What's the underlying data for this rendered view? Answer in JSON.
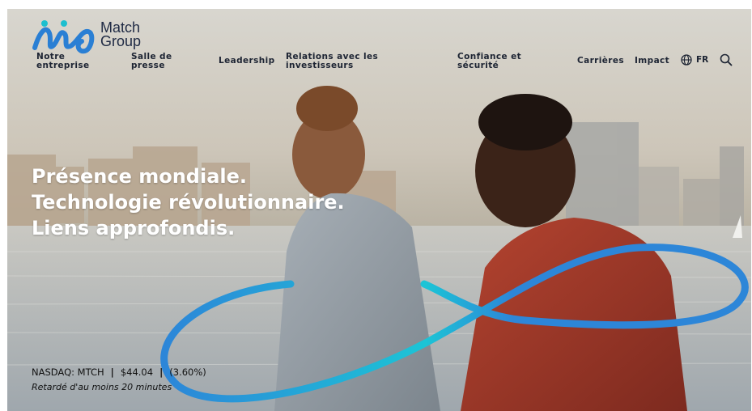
{
  "brand": {
    "name_line1": "Match",
    "name_line2": "Group"
  },
  "nav": {
    "items": [
      {
        "label_line1": "Notre",
        "label_line2": "entreprise"
      },
      {
        "label_line1": "Salle de",
        "label_line2": "presse"
      },
      {
        "label_line1": "Leadership",
        "label_line2": ""
      },
      {
        "label_line1": "Relations avec les",
        "label_line2": "investisseurs"
      },
      {
        "label_line1": "Confiance et",
        "label_line2": "sécurité"
      },
      {
        "label_line1": "Carrières",
        "label_line2": ""
      },
      {
        "label_line1": "Impact",
        "label_line2": ""
      }
    ],
    "language": "FR"
  },
  "hero": {
    "headline_lines": [
      "Présence mondiale.",
      "Technologie révolutionnaire.",
      "Liens approfondis."
    ]
  },
  "stock": {
    "ticker": "NASDAQ: MTCH",
    "price": "$44.04",
    "change": "(3.60%)",
    "delay_note": "Retardé d'au moins 20 minutes"
  },
  "colors": {
    "logo_blue": "#2a7fd4",
    "logo_teal": "#1dbfcf",
    "ribbon_blue": "#2d86d8",
    "ribbon_teal": "#1cc4d6",
    "nav_text": "#1d2433"
  },
  "icons": [
    "globe-icon",
    "search-icon",
    "match-group-logo-icon"
  ]
}
